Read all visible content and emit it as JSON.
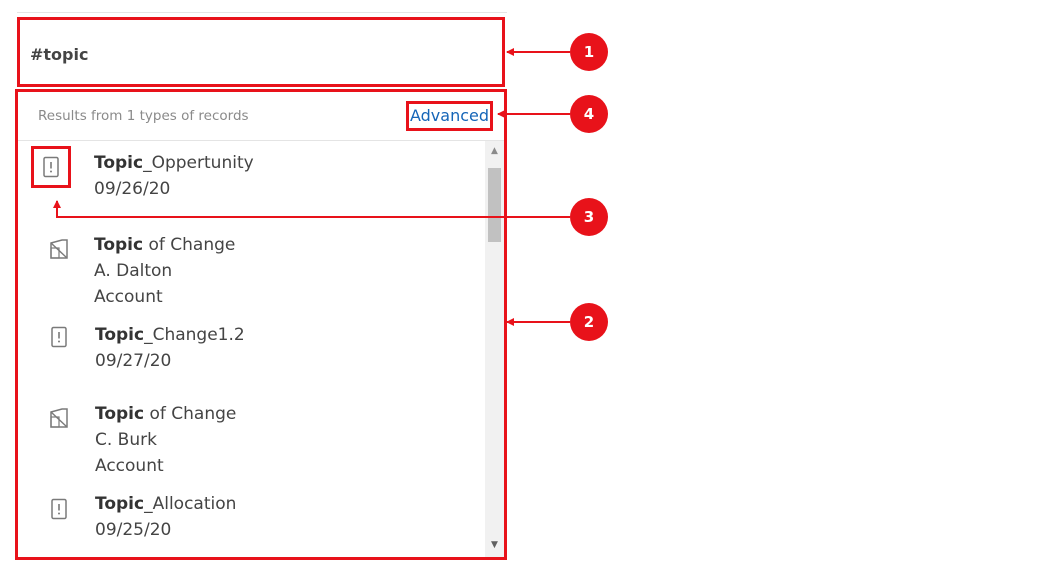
{
  "search": {
    "value": "#topic"
  },
  "results": {
    "caption": "Results from 1 types of records",
    "advanced_label": "Advanced",
    "items": [
      {
        "icon": "opportunity-icon",
        "title_bold": "Topic",
        "title_rest": "_Oppertunity",
        "lines": [
          "09/26/20"
        ]
      },
      {
        "icon": "account-icon",
        "title_bold": "Topic",
        "title_rest": " of Change",
        "lines": [
          "A. Dalton",
          "Account"
        ]
      },
      {
        "icon": "opportunity-icon",
        "title_bold": "Topic",
        "title_rest": "_Change1.2",
        "lines": [
          "09/27/20"
        ]
      },
      {
        "icon": "account-icon",
        "title_bold": "Topic",
        "title_rest": " of Change",
        "lines": [
          "C. Burk",
          "Account"
        ]
      },
      {
        "icon": "opportunity-icon",
        "title_bold": "Topic",
        "title_rest": "_Allocation",
        "lines": [
          "09/25/20"
        ]
      }
    ]
  },
  "callouts": {
    "c1": "1",
    "c2": "2",
    "c3": "3",
    "c4": "4"
  },
  "colors": {
    "callout": "#e8121a",
    "link": "#1565b8"
  }
}
